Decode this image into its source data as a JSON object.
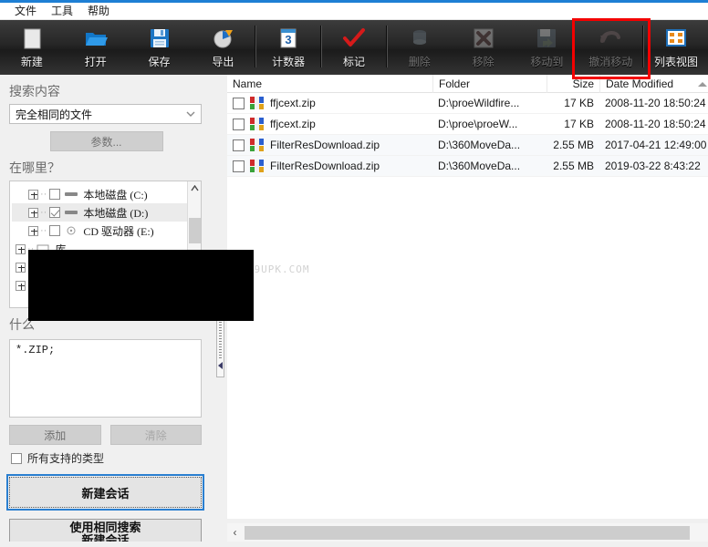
{
  "window": {
    "accent_color": "#1e7fd4",
    "annotation_color": "#f30000",
    "watermark": "WWW.9UPK.COM"
  },
  "menubar": {
    "items": [
      {
        "label": "文件",
        "name": "menu-file"
      },
      {
        "label": "工具",
        "name": "menu-tools"
      },
      {
        "label": "帮助",
        "name": "menu-help"
      }
    ]
  },
  "toolbar": {
    "buttons": [
      {
        "label": "新建",
        "icon": "new-document-icon",
        "enabled": true
      },
      {
        "label": "打开",
        "icon": "open-folder-icon",
        "enabled": true
      },
      {
        "label": "保存",
        "icon": "save-disk-icon",
        "enabled": true
      },
      {
        "label": "导出",
        "icon": "export-chart-icon",
        "enabled": true
      },
      {
        "label": "计数器",
        "icon": "counter-icon",
        "enabled": true
      },
      {
        "label": "标记",
        "icon": "checkmark-icon",
        "enabled": true
      },
      {
        "label": "删除",
        "icon": "delete-bin-icon",
        "enabled": false
      },
      {
        "label": "移除",
        "icon": "remove-x-icon",
        "enabled": false
      },
      {
        "label": "移动到",
        "icon": "move-to-icon",
        "enabled": false
      },
      {
        "label": "撤消移动",
        "icon": "undo-move-icon",
        "enabled": false
      },
      {
        "label": "列表视图",
        "icon": "list-view-icon",
        "enabled": true
      }
    ]
  },
  "sidebar": {
    "search_content": {
      "title": "搜索内容",
      "combo_value": "完全相同的文件",
      "params_button": "参数..."
    },
    "where": {
      "title": "在哪里？",
      "tree": [
        {
          "label": "本地磁盘 (C:)",
          "checked": false,
          "selected": false,
          "icon": "hard-disk-icon"
        },
        {
          "label": "本地磁盘 (D:)",
          "checked": true,
          "selected": true,
          "icon": "hard-disk-icon"
        },
        {
          "label": "CD 驱动器 (E:)",
          "checked": false,
          "selected": false,
          "icon": "cd-drive-icon"
        },
        {
          "label": "库",
          "checked": false,
          "selected": false,
          "icon": "library-icon"
        }
      ]
    },
    "what": {
      "title": "什么",
      "filetypes": "*.ZIP;",
      "add_button": "添加",
      "clear_button": "清除",
      "all_types_label": "所有支持的类型",
      "all_types_checked": false
    },
    "actions": {
      "new_session": "新建会话",
      "same_search_line1": "使用相同搜索",
      "same_search_line2": "新建会话"
    }
  },
  "filelist": {
    "columns": [
      {
        "key": "name",
        "label": "Name"
      },
      {
        "key": "folder",
        "label": "Folder"
      },
      {
        "key": "size",
        "label": "Size"
      },
      {
        "key": "date",
        "label": "Date Modified",
        "sorted": "asc"
      }
    ],
    "rows": [
      {
        "checked": false,
        "name": "ffjcext.zip",
        "folder": "D:\\proeWildfire...",
        "size": "17 KB",
        "date": "2008-11-20 18:50:24"
      },
      {
        "checked": false,
        "name": "ffjcext.zip",
        "folder": "D:\\proe\\proeW...",
        "size": "17 KB",
        "date": "2008-11-20 18:50:24"
      },
      {
        "checked": false,
        "name": "FilterResDownload.zip",
        "folder": "D:\\360MoveDa...",
        "size": "2.55 MB",
        "date": "2017-04-21 12:49:00"
      },
      {
        "checked": false,
        "name": "FilterResDownload.zip",
        "folder": "D:\\360MoveDa...",
        "size": "2.55 MB",
        "date": "2019-03-22 8:43:22"
      }
    ]
  },
  "scrollbars": {
    "horizontal_left_arrow": "‹"
  }
}
